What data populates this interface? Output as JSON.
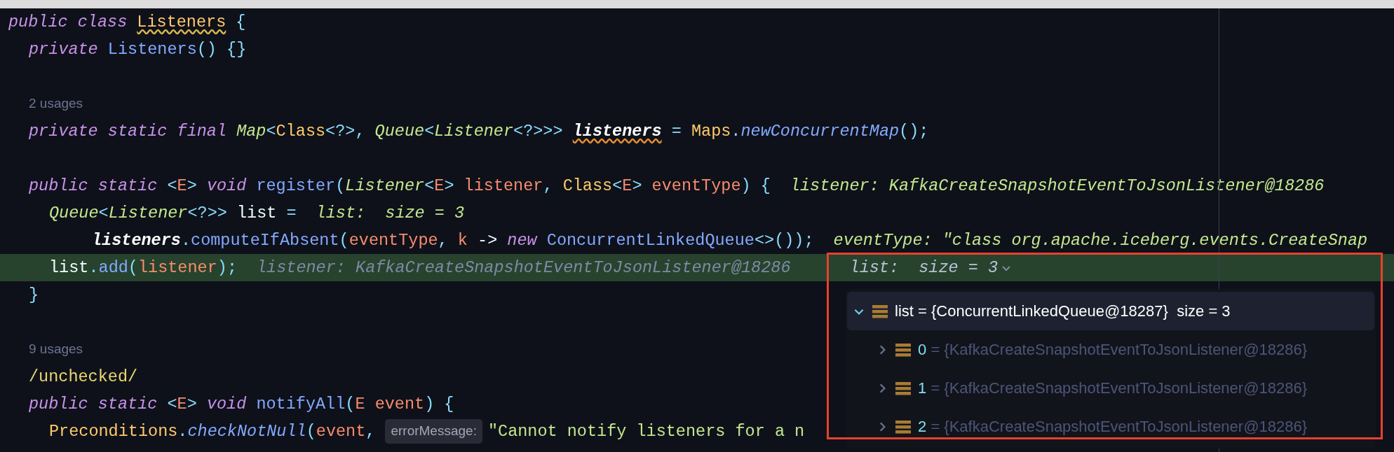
{
  "editor": {
    "lines": [
      {
        "kind": "code",
        "current": false,
        "tokens": [
          {
            "text": "public class ",
            "kind": "kw"
          },
          {
            "text": "Listeners",
            "kind": "cls_warn"
          },
          {
            "text": " {",
            "kind": "punct"
          }
        ],
        "children": [
          {
            "kind": "code",
            "current": false,
            "tokens": [
              {
                "text": "private ",
                "kind": "kw"
              },
              {
                "text": "Listeners",
                "kind": "fn"
              },
              {
                "text": "() {}",
                "kind": "punct"
              }
            ]
          },
          {
            "kind": "blank"
          },
          {
            "kind": "usages",
            "text": "2 usages"
          },
          {
            "kind": "code",
            "current": false,
            "tokens": [
              {
                "text": "private static final ",
                "kind": "kw"
              },
              {
                "text": "Map",
                "kind": "type"
              },
              {
                "text": "<",
                "kind": "punct"
              },
              {
                "text": "Class",
                "kind": "cls"
              },
              {
                "text": "<?>, ",
                "kind": "punct"
              },
              {
                "text": "Queue",
                "kind": "type"
              },
              {
                "text": "<",
                "kind": "punct"
              },
              {
                "text": "Listener",
                "kind": "type"
              },
              {
                "text": "<?>>> ",
                "kind": "punct"
              },
              {
                "text": "listeners",
                "kind": "field_warn"
              },
              {
                "text": " = ",
                "kind": "punct"
              },
              {
                "text": "Maps",
                "kind": "cls"
              },
              {
                "text": ".",
                "kind": "punct"
              },
              {
                "text": "newConcurrentMap",
                "kind": "fn_i"
              },
              {
                "text": "();",
                "kind": "punct"
              }
            ]
          },
          {
            "kind": "blank"
          },
          {
            "kind": "code",
            "current": false,
            "tokens": [
              {
                "text": "public static ",
                "kind": "kw"
              },
              {
                "text": "<",
                "kind": "punct"
              },
              {
                "text": "E",
                "kind": "param"
              },
              {
                "text": "> ",
                "kind": "punct"
              },
              {
                "text": "void ",
                "kind": "kw"
              },
              {
                "text": "register",
                "kind": "fn"
              },
              {
                "text": "(",
                "kind": "punct"
              },
              {
                "text": "Listener",
                "kind": "type"
              },
              {
                "text": "<",
                "kind": "punct"
              },
              {
                "text": "E",
                "kind": "param"
              },
              {
                "text": "> ",
                "kind": "punct"
              },
              {
                "text": "listener",
                "kind": "param"
              },
              {
                "text": ", ",
                "kind": "punct"
              },
              {
                "text": "Class",
                "kind": "cls"
              },
              {
                "text": "<",
                "kind": "punct"
              },
              {
                "text": "E",
                "kind": "param"
              },
              {
                "text": "> ",
                "kind": "punct"
              },
              {
                "text": "eventType",
                "kind": "param"
              },
              {
                "text": ") {",
                "kind": "punct"
              },
              {
                "text": "listener: KafkaCreateSnapshotEventToJsonListener@18286",
                "kind": "hint_value"
              }
            ],
            "children": [
              {
                "kind": "code",
                "current": false,
                "tokens": [
                  {
                    "text": "Queue",
                    "kind": "type"
                  },
                  {
                    "text": "<",
                    "kind": "punct"
                  },
                  {
                    "text": "Listener",
                    "kind": "type"
                  },
                  {
                    "text": "<?>> ",
                    "kind": "punct"
                  },
                  {
                    "text": "list ",
                    "kind": "plain"
                  },
                  {
                    "text": "=",
                    "kind": "punct"
                  },
                  {
                    "text": "list:  size = 3",
                    "kind": "hint_value"
                  }
                ],
                "children": [
                  {
                    "kind": "continuation",
                    "current": false,
                    "tokens": [
                      {
                        "text": "listeners",
                        "kind": "field"
                      },
                      {
                        "text": ".",
                        "kind": "punct"
                      },
                      {
                        "text": "computeIfAbsent",
                        "kind": "fn"
                      },
                      {
                        "text": "(",
                        "kind": "punct"
                      },
                      {
                        "text": "eventType",
                        "kind": "param"
                      },
                      {
                        "text": ", ",
                        "kind": "punct"
                      },
                      {
                        "text": "k ",
                        "kind": "param"
                      },
                      {
                        "text": "-> ",
                        "kind": "plain"
                      },
                      {
                        "text": "new ",
                        "kind": "kw"
                      },
                      {
                        "text": "ConcurrentLinkedQueue",
                        "kind": "fn"
                      },
                      {
                        "text": "<>());",
                        "kind": "punct"
                      },
                      {
                        "text": "eventType: \"class org.apache.iceberg.events.CreateSnap",
                        "kind": "hint_value"
                      }
                    ]
                  }
                ]
              },
              {
                "kind": "code",
                "current": true,
                "tokens": [
                  {
                    "text": "list",
                    "kind": "plain"
                  },
                  {
                    "text": ".",
                    "kind": "punct"
                  },
                  {
                    "text": "add",
                    "kind": "fn"
                  },
                  {
                    "text": "(",
                    "kind": "punct"
                  },
                  {
                    "text": "listener",
                    "kind": "param"
                  },
                  {
                    "text": ");",
                    "kind": "punct"
                  },
                  {
                    "text": "listener: KafkaCreateSnapshotEventToJsonListener@18286",
                    "kind": "hint_muted"
                  },
                  {
                    "text": "list:  size = 3",
                    "kind": "hint_dropdown"
                  }
                ]
              }
            ]
          },
          {
            "kind": "code",
            "current": false,
            "tokens": [
              {
                "text": "}",
                "kind": "punct"
              }
            ]
          },
          {
            "kind": "blank"
          },
          {
            "kind": "usages",
            "text": "9 usages"
          },
          {
            "kind": "code",
            "current": false,
            "tokens": [
              {
                "text": "/unchecked/",
                "kind": "annot"
              }
            ]
          },
          {
            "kind": "code",
            "current": false,
            "tokens": [
              {
                "text": "public static ",
                "kind": "kw"
              },
              {
                "text": "<",
                "kind": "punct"
              },
              {
                "text": "E",
                "kind": "param"
              },
              {
                "text": "> ",
                "kind": "punct"
              },
              {
                "text": "void ",
                "kind": "kw"
              },
              {
                "text": "notifyAll",
                "kind": "fn"
              },
              {
                "text": "(",
                "kind": "punct"
              },
              {
                "text": "E event",
                "kind": "param"
              },
              {
                "text": ") {",
                "kind": "punct"
              }
            ],
            "children": [
              {
                "kind": "code",
                "current": false,
                "tokens": [
                  {
                    "text": "Preconditions",
                    "kind": "cls"
                  },
                  {
                    "text": ".",
                    "kind": "punct"
                  },
                  {
                    "text": "checkNotNull",
                    "kind": "fn_i"
                  },
                  {
                    "text": "(",
                    "kind": "punct"
                  },
                  {
                    "text": "event",
                    "kind": "param"
                  },
                  {
                    "text": ",",
                    "kind": "punct"
                  },
                  {
                    "text": "errorMessage:",
                    "kind": "hint_chip"
                  },
                  {
                    "text": "\"Cannot notify listeners for a n",
                    "kind": "str"
                  }
                ]
              }
            ]
          }
        ]
      }
    ]
  },
  "debug_popup": {
    "tree": [
      {
        "name": "list",
        "value": "= {ConcurrentLinkedQueue@18287}",
        "extra": "size = 3",
        "expanded": true,
        "selected": true,
        "children": [
          {
            "name": "0",
            "value": "= {KafkaCreateSnapshotEventToJsonListener@18286}",
            "expanded": false,
            "selected": false
          },
          {
            "name": "1",
            "value": "= {KafkaCreateSnapshotEventToJsonListener@18286}",
            "expanded": false,
            "selected": false
          },
          {
            "name": "2",
            "value": "= {KafkaCreateSnapshotEventToJsonListener@18286}",
            "expanded": false,
            "selected": false
          }
        ]
      }
    ]
  }
}
